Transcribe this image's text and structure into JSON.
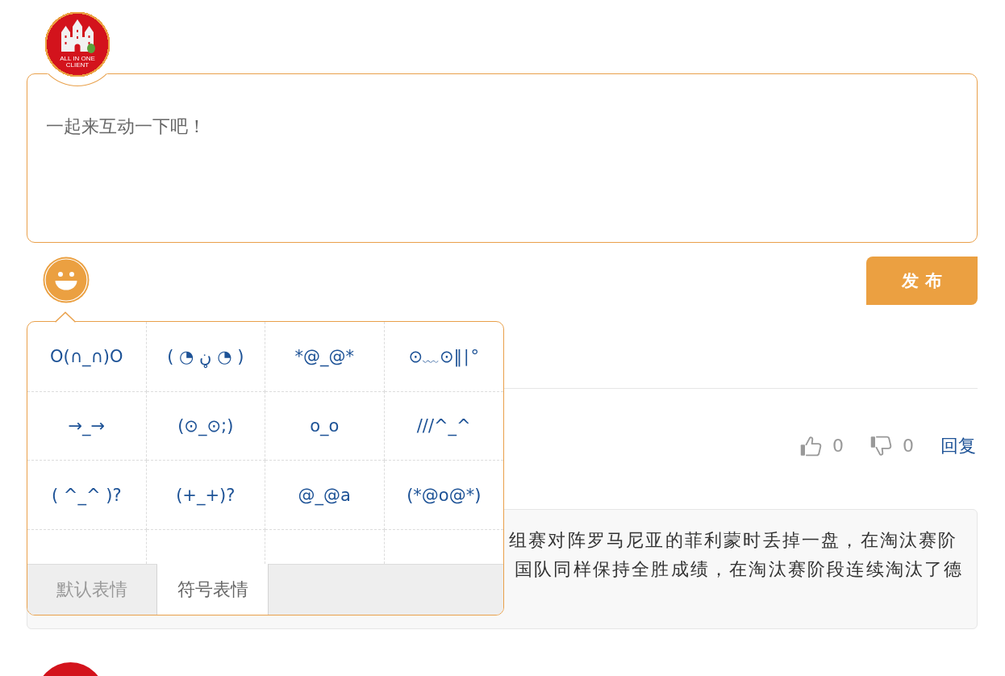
{
  "logo": {
    "text_lines": [
      "ALL IN ONE",
      "CLIENT"
    ]
  },
  "comment_box": {
    "placeholder": "一起来互动一下吧！"
  },
  "publish_button": {
    "label": "发 布"
  },
  "emoticon_picker": {
    "open": true,
    "emoticons": [
      "O(∩_∩)O",
      "( ◔ ڼ ◔ )",
      "*@_@*",
      "⊙﹏⊙‖∣°",
      "→_→",
      "(⊙_⊙;)",
      "o_o",
      "///^_^",
      "( ^_^ )?",
      "(+_+)?",
      "@_@a",
      "(*@o@*)"
    ],
    "tabs": [
      {
        "label": "默认表情",
        "selected": false
      },
      {
        "label": "符号表情",
        "selected": true
      }
    ]
  },
  "comment": {
    "likes": "0",
    "dislikes": "0",
    "reply_link": "回复",
    "quote_lines": [
      "组赛对阵罗马尼亚的菲利蒙时丢掉一盘，在淘汰赛阶",
      "国队同样保持全胜成绩，在淘汰赛阶段连续淘汰了德"
    ]
  }
}
